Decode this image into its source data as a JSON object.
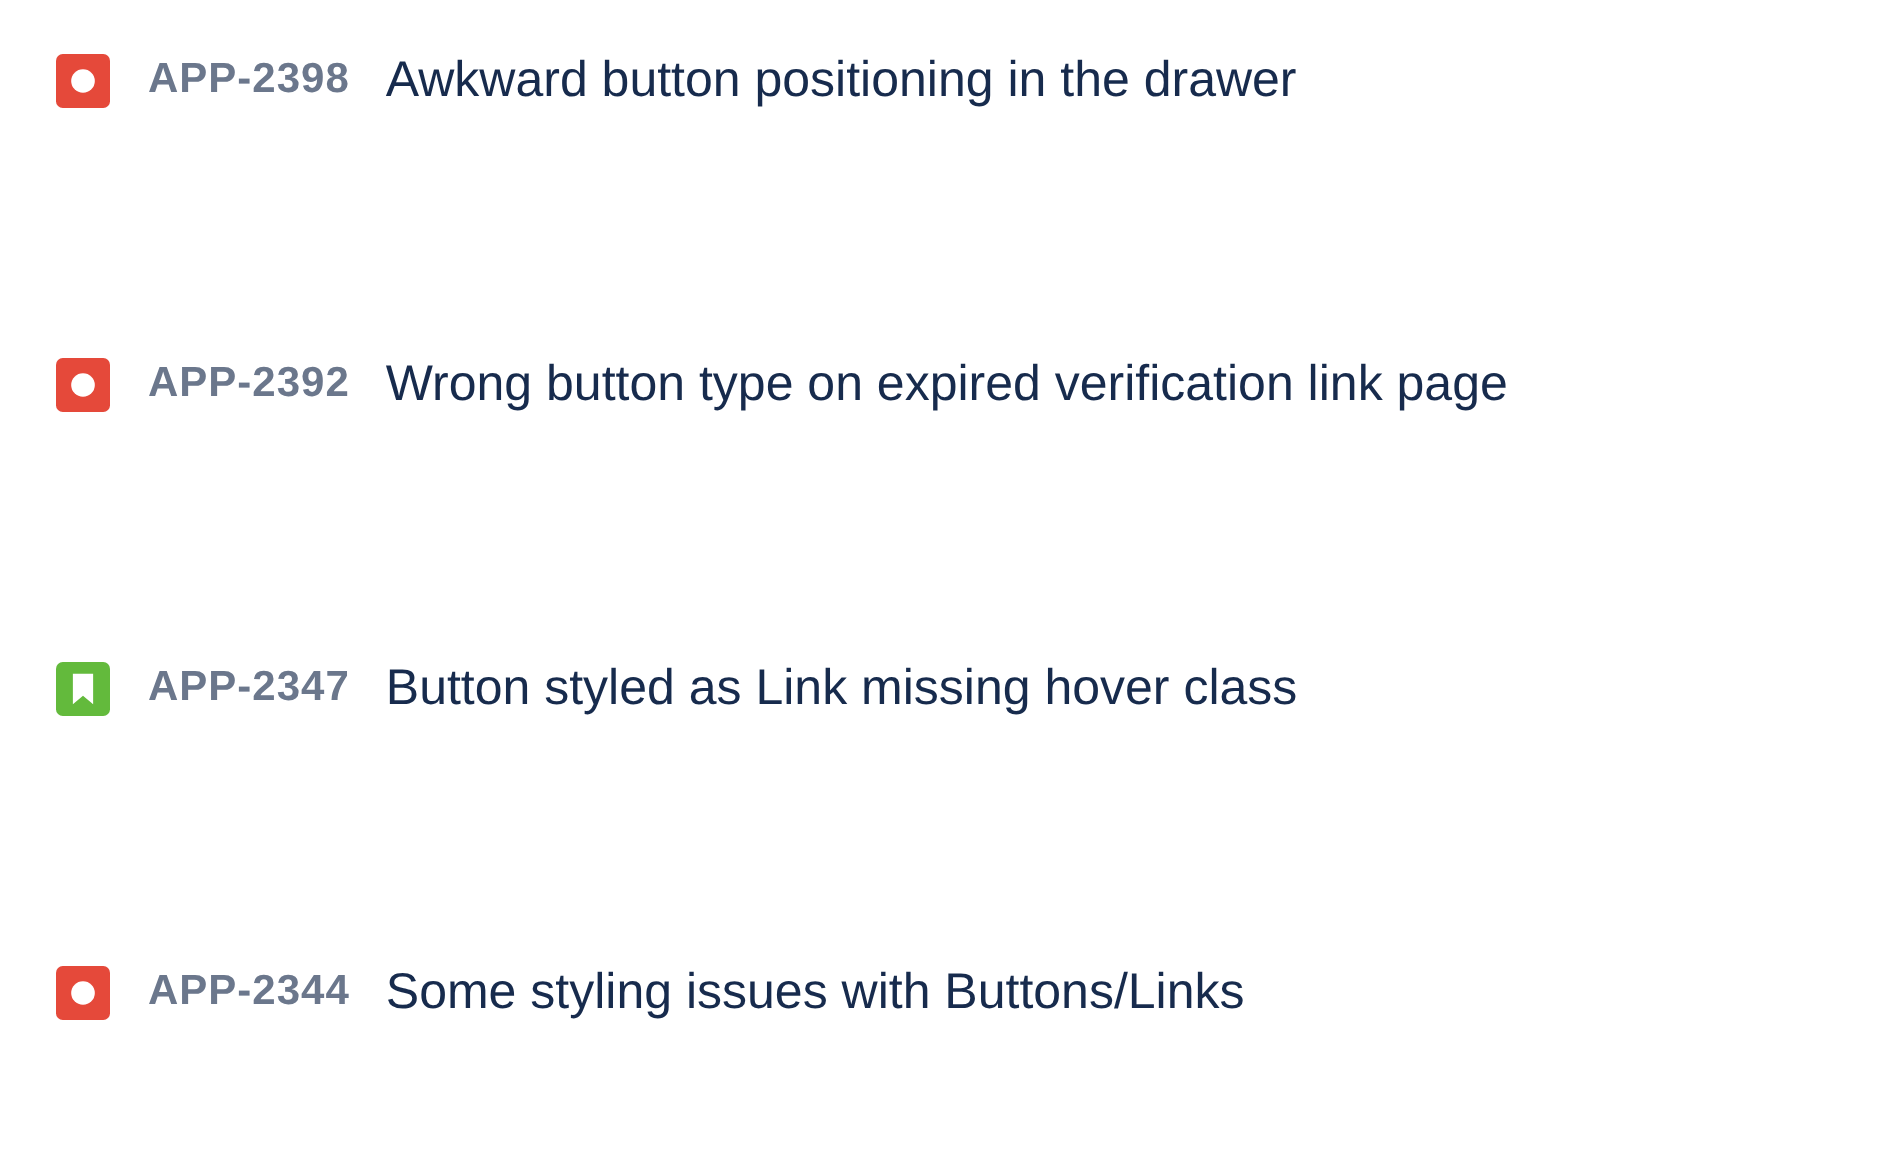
{
  "issues": [
    {
      "kind": "bug",
      "key": "APP-2398",
      "summary": "Awkward button positioning in the drawer"
    },
    {
      "kind": "bug",
      "key": "APP-2392",
      "summary": "Wrong button type on expired verification link page"
    },
    {
      "kind": "story",
      "key": "APP-2347",
      "summary": "Button styled as Link missing hover class"
    },
    {
      "kind": "bug",
      "key": "APP-2344",
      "summary": "Some styling issues with Buttons/Links"
    }
  ]
}
